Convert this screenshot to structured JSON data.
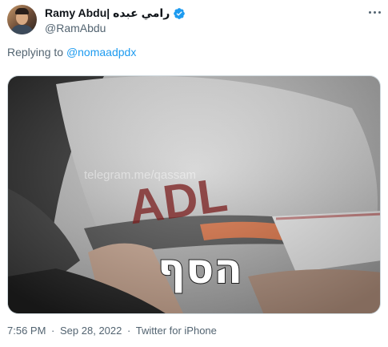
{
  "tweet": {
    "author": {
      "display_name": "Ramy Abdu| رامي عبده",
      "handle": "@RamAbdu",
      "verified": true,
      "verified_color": "#1d9bf0"
    },
    "reply": {
      "prefix": "Replying to",
      "mention": "@nomaadpdx"
    },
    "media": {
      "overlay_text": "הסף",
      "watermark_text": "telegram.me/qassam",
      "graffiti_text": "ADL"
    },
    "meta": {
      "time": "7:56 PM",
      "date": "Sep 28, 2022",
      "source": "Twitter for iPhone",
      "separator": "·"
    },
    "icons": {
      "more": "more-horizontal-icon",
      "verified": "verified-badge-icon"
    }
  }
}
